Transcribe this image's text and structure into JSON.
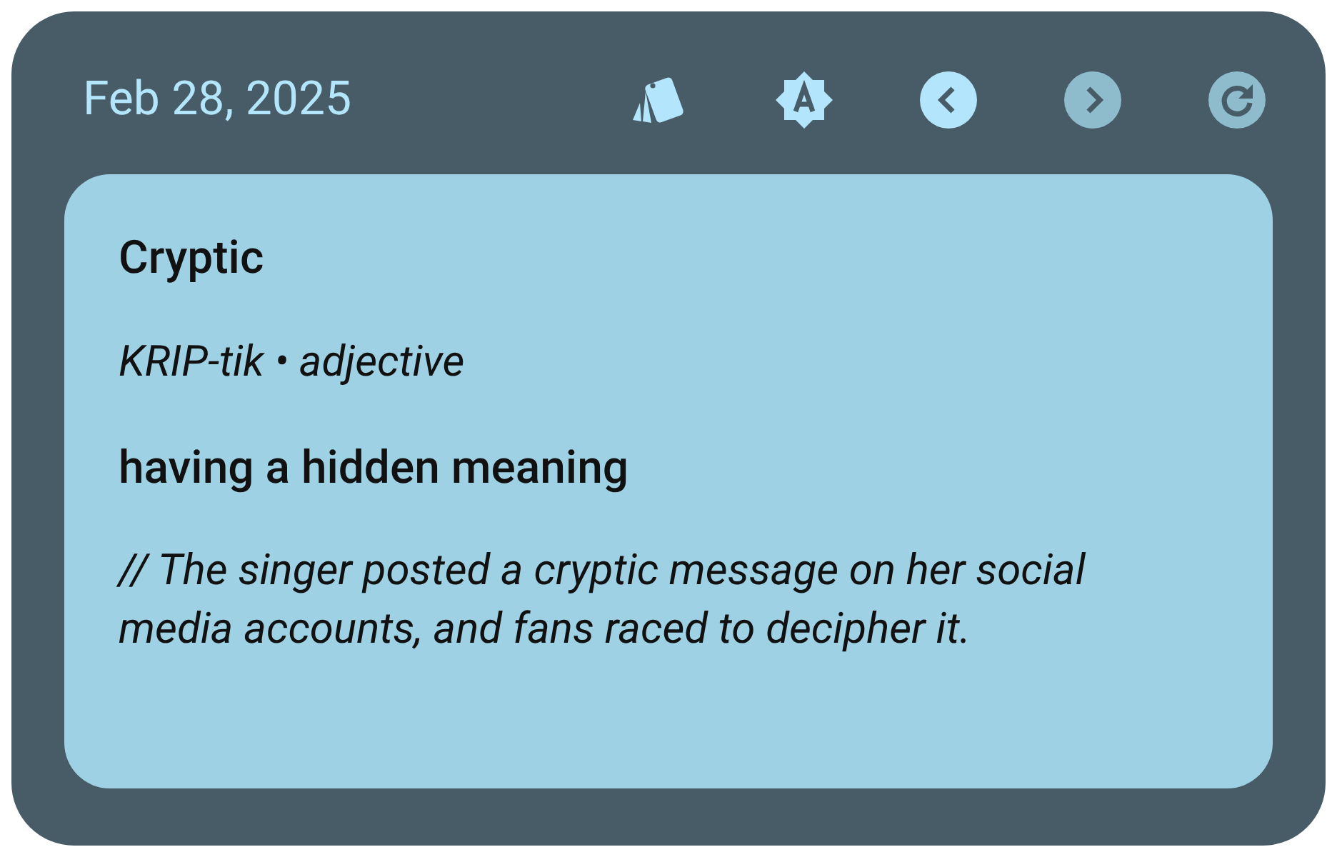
{
  "header": {
    "date": "Feb 28, 2025"
  },
  "toolbar": [
    {
      "kind": "cards",
      "disabled": false
    },
    {
      "kind": "brightness",
      "disabled": false
    },
    {
      "kind": "previous",
      "disabled": false
    },
    {
      "kind": "next",
      "disabled": true
    },
    {
      "kind": "refresh",
      "disabled": true
    }
  ],
  "card": {
    "word": "Cryptic",
    "pronunciation": "KRIP-tik • adjective",
    "definition": "having a hidden meaning",
    "example": "// The singer posted a cryptic message on her social media accounts, and fans raced to decipher it."
  }
}
